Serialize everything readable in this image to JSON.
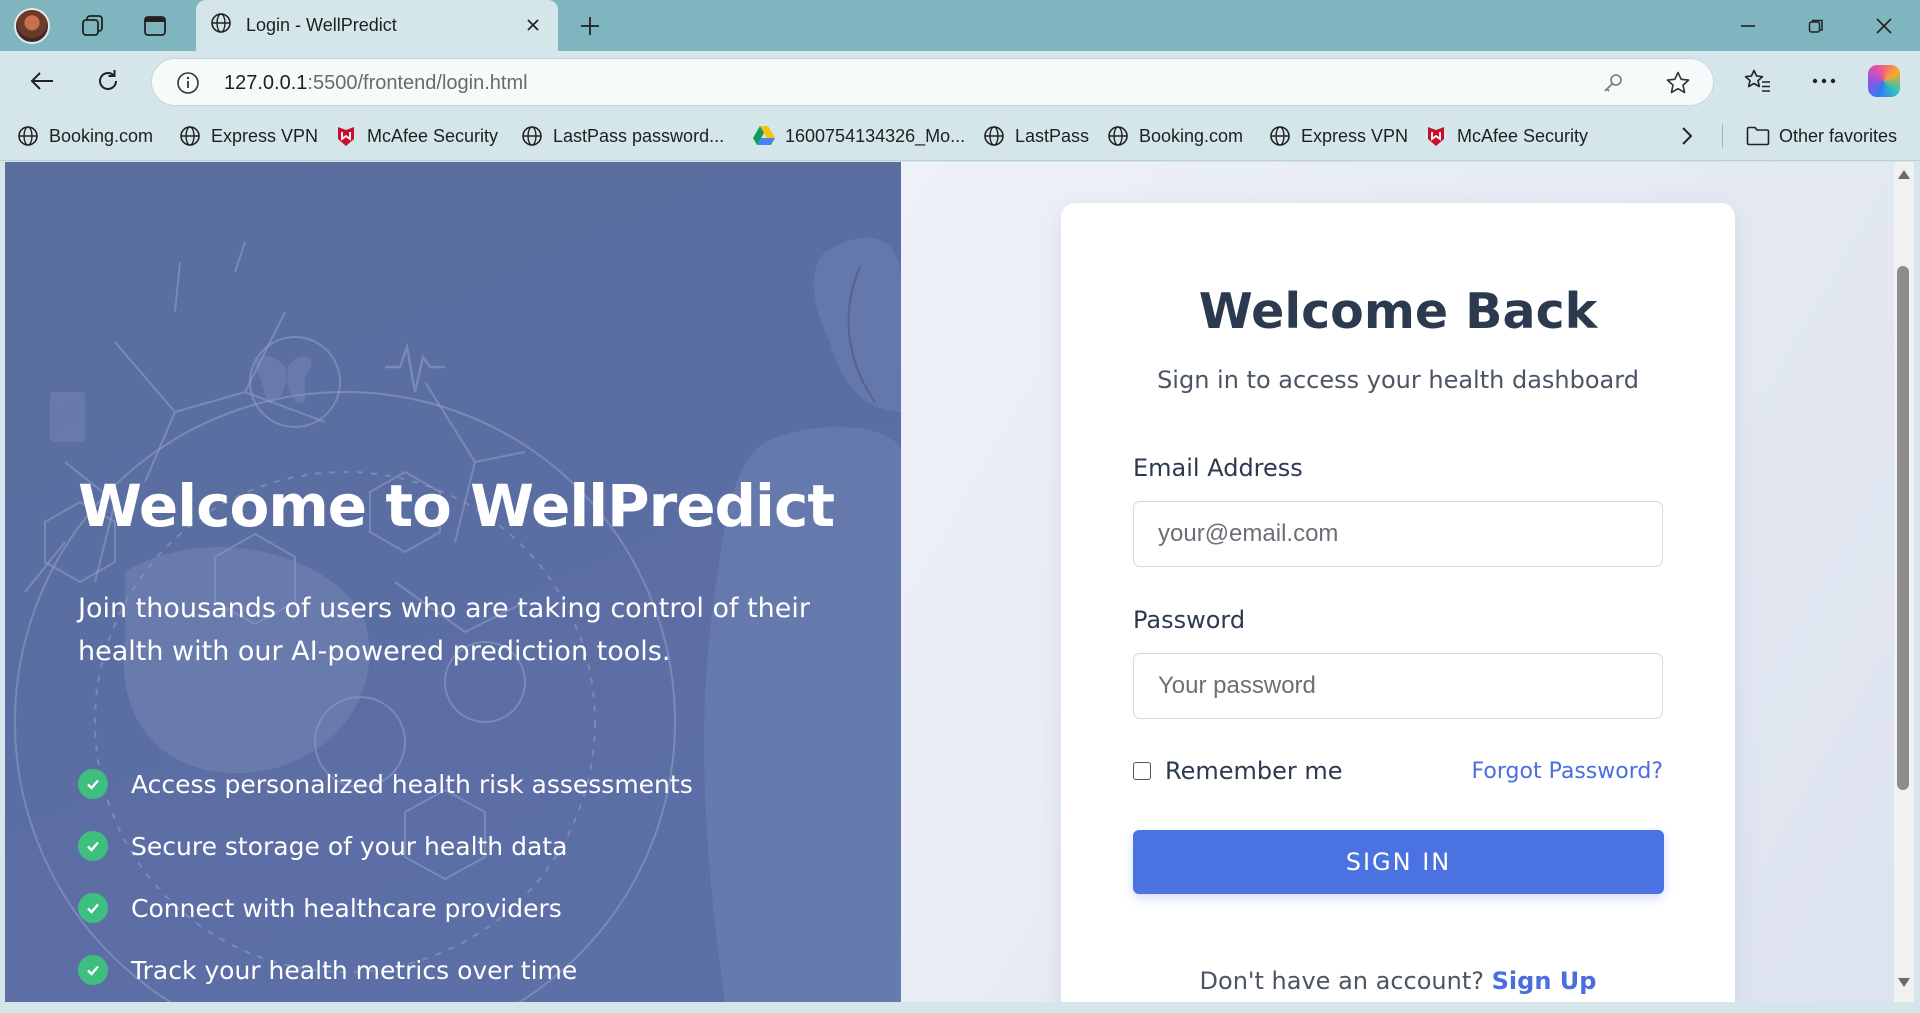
{
  "browser": {
    "tab_title": "Login - WellPredict",
    "url_host": "127.0.0.1",
    "url_rest": ":5500/frontend/login.html",
    "favorites": [
      {
        "label": "Booking.com",
        "icon": "globe-icon"
      },
      {
        "label": "Express VPN",
        "icon": "globe-icon"
      },
      {
        "label": "McAfee Security",
        "icon": "mcafee-icon"
      },
      {
        "label": "LastPass password...",
        "icon": "globe-icon"
      },
      {
        "label": "1600754134326_Mo...",
        "icon": "google-drive-icon"
      },
      {
        "label": "LastPass",
        "icon": "globe-icon"
      },
      {
        "label": "Booking.com",
        "icon": "globe-icon"
      },
      {
        "label": "Express VPN",
        "icon": "globe-icon"
      },
      {
        "label": "McAfee Security",
        "icon": "mcafee-icon"
      }
    ],
    "other_favorites": "Other favorites"
  },
  "hero": {
    "title": "Welcome to WellPredict",
    "subtitle": "Join thousands of users who are taking control of their health with our AI-powered prediction tools.",
    "features": [
      "Access personalized health risk assessments",
      "Secure storage of your health data",
      "Connect with healthcare providers",
      "Track your health metrics over time"
    ]
  },
  "login": {
    "title": "Welcome Back",
    "subtitle": "Sign in to access your health dashboard",
    "email_label": "Email Address",
    "email_placeholder": "your@email.com",
    "password_label": "Password",
    "password_placeholder": "Your password",
    "remember_label": "Remember me",
    "forgot_label": "Forgot Password?",
    "signin_label": "SIGN IN",
    "signup_prompt": "Don't have an account?",
    "signup_link": "Sign Up"
  },
  "colors": {
    "accent": "#4a72e0",
    "check_green": "#3fbf7f",
    "hero_bg": "#5b6ea3",
    "title_dark": "#2c3a50"
  }
}
